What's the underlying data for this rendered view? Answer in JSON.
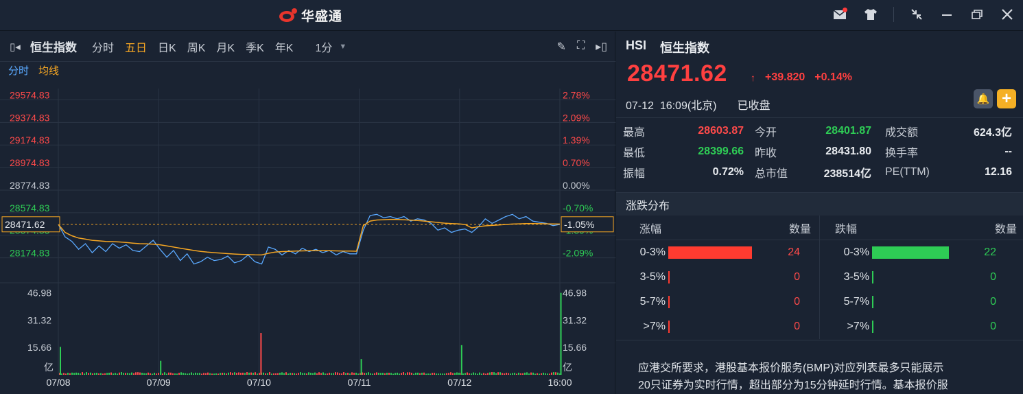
{
  "app": {
    "logo_text": "华盛通",
    "colors": {
      "up": "#ff4040",
      "down": "#2ecc55",
      "accent": "#f5a623",
      "price_line": "#5aa9ff"
    }
  },
  "window_controls": [
    "mail-icon",
    "shirt-icon",
    "compress-icon",
    "minimize-icon",
    "restore-icon",
    "close-icon"
  ],
  "toolbar": {
    "index_name": "恒生指数",
    "tabs": [
      {
        "label": "分时",
        "active": false
      },
      {
        "label": "五日",
        "active": true
      },
      {
        "label": "日K",
        "active": false
      },
      {
        "label": "周K",
        "active": false
      },
      {
        "label": "月K",
        "active": false
      },
      {
        "label": "季K",
        "active": false
      },
      {
        "label": "年K",
        "active": false
      }
    ],
    "period": "1分",
    "right_icons": [
      "pencil-icon",
      "fullscreen-icon",
      "collapse-right-icon"
    ]
  },
  "chart_legend": {
    "price": "分时",
    "avg": "均线"
  },
  "chart_data": {
    "type": "line",
    "title": "",
    "x_labels": [
      "07/08",
      "07/09",
      "07/10",
      "07/11",
      "07/12",
      "16:00"
    ],
    "y_left_labels": [
      "29574.83",
      "29374.83",
      "29174.83",
      "28974.83",
      "28774.83",
      "28574.83",
      "28374.83",
      "28174.83"
    ],
    "y_right_labels": [
      "2.78%",
      "2.09%",
      "1.39%",
      "0.70%",
      "0.00%",
      "-0.70%",
      "-1.39%",
      "-2.09%"
    ],
    "current_price_label": "28471.62",
    "current_pct_label": "-1.05%",
    "ylim": [
      28074.83,
      29674.83
    ],
    "reference_price": 28774.83,
    "series": [
      {
        "name": "分时",
        "color": "#5aa9ff",
        "values": [
          28470,
          28360,
          28320,
          28250,
          28300,
          28220,
          28280,
          28230,
          28300,
          28260,
          28290,
          28240,
          28230,
          28280,
          28330,
          28250,
          28180,
          28240,
          28150,
          28210,
          28120,
          28140,
          28180,
          28150,
          28160,
          28190,
          28130,
          28150,
          28200,
          28140,
          28120,
          28270,
          28250,
          28200,
          28240,
          28210,
          28260,
          28230,
          28250,
          28220,
          28240,
          28200,
          28230,
          28210,
          28210,
          28420,
          28550,
          28560,
          28530,
          28540,
          28520,
          28540,
          28500,
          28520,
          28510,
          28480,
          28420,
          28440,
          28400,
          28420,
          28430,
          28400,
          28450,
          28520,
          28480,
          28510,
          28540,
          28560,
          28520,
          28540,
          28500,
          28490,
          28480,
          28460,
          28470
        ]
      },
      {
        "name": "均线",
        "color": "#f5a623",
        "values": [
          28470,
          28400,
          28370,
          28350,
          28340,
          28330,
          28325,
          28320,
          28318,
          28315,
          28310,
          28305,
          28300,
          28298,
          28295,
          28290,
          28280,
          28270,
          28260,
          28250,
          28240,
          28232,
          28225,
          28220,
          28216,
          28212,
          28208,
          28205,
          28203,
          28201,
          28200,
          28215,
          28225,
          28230,
          28232,
          28234,
          28236,
          28238,
          28238,
          28238,
          28237,
          28236,
          28235,
          28234,
          28233,
          28460,
          28500,
          28510,
          28512,
          28515,
          28514,
          28512,
          28508,
          28505,
          28500,
          28494,
          28488,
          28482,
          28478,
          28476,
          28470,
          28440,
          28450,
          28458,
          28462,
          28466,
          28470,
          28474,
          28476,
          28478,
          28478,
          28477,
          28476,
          28475,
          28474
        ]
      }
    ],
    "volume": {
      "unit": "亿",
      "y_labels": [
        "46.98",
        "31.32",
        "15.66"
      ],
      "ylim": [
        0,
        50
      ],
      "spikes": [
        {
          "day": 0,
          "value": 16
        },
        {
          "day": 1,
          "value": 8
        },
        {
          "day": 2,
          "value": 24
        },
        {
          "day": 3,
          "value": 9
        },
        {
          "day": 4,
          "value": 17
        },
        {
          "day": 4.99,
          "value": 47
        }
      ]
    }
  },
  "quote": {
    "code": "HSI",
    "name": "恒生指数",
    "price": "28471.62",
    "arrow": "↑",
    "change": "+39.820",
    "change_pct": "+0.14%",
    "time": "07-12  16:09(北京)",
    "status": "已收盘"
  },
  "stats": [
    [
      {
        "label": "最高",
        "value": "28603.87",
        "color": "red"
      },
      {
        "label": "今开",
        "value": "28401.87",
        "color": "green"
      },
      {
        "label": "成交额",
        "value": "624.3亿",
        "color": "white"
      }
    ],
    [
      {
        "label": "最低",
        "value": "28399.66",
        "color": "green"
      },
      {
        "label": "昨收",
        "value": "28431.80",
        "color": "white"
      },
      {
        "label": "换手率",
        "value": "--",
        "color": "white"
      }
    ],
    [
      {
        "label": "振幅",
        "value": "0.72%",
        "color": "white"
      },
      {
        "label": "总市值",
        "value": "238514亿",
        "color": "white"
      },
      {
        "label": "PE(TTM)",
        "value": "12.16",
        "color": "white"
      }
    ]
  ],
  "distribution": {
    "title": "涨跌分布",
    "up_header": "涨幅",
    "down_header": "跌幅",
    "count_header": "数量",
    "rows": [
      {
        "up_range": "0-3%",
        "up_count": "24",
        "down_range": "0-3%",
        "down_count": "22"
      },
      {
        "up_range": "3-5%",
        "up_count": "0",
        "down_range": "3-5%",
        "down_count": "0"
      },
      {
        "up_range": "5-7%",
        "up_count": "0",
        "down_range": "5-7%",
        "down_count": "0"
      },
      {
        "up_range": ">7%",
        "up_count": "0",
        "down_range": ">7%",
        "down_count": "0"
      }
    ]
  },
  "notice": {
    "line1": "应港交所要求，港股基本报价服务(BMP)对应列表最多只能展示",
    "line2": "20只证券为实时行情，超出部分为15分钟延时行情。基本报价服"
  }
}
